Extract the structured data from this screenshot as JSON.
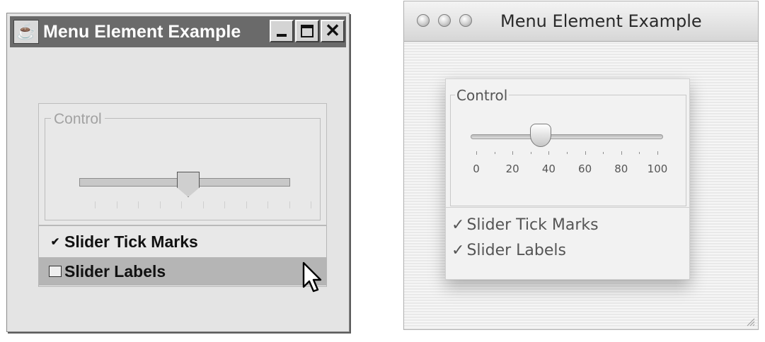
{
  "windows_example": {
    "title": "Menu Element Example",
    "app_icon": "java-cup-icon",
    "controls": {
      "minimize": "minimize-icon",
      "maximize": "maximize-icon",
      "close_label": "✕"
    },
    "group_label": "Control",
    "slider": {
      "value": 50,
      "min": 0,
      "max": 100
    },
    "menu": [
      {
        "label": "Slider Tick Marks",
        "checked": true,
        "check_glyph": "✔",
        "highlighted": false
      },
      {
        "label": "Slider Labels",
        "checked": false,
        "check_glyph": "",
        "highlighted": true
      }
    ]
  },
  "mac_example": {
    "title": "Menu Element Example",
    "group_label": "Control",
    "slider": {
      "value": 38,
      "min": 0,
      "max": 100
    },
    "tick_labels": [
      "0",
      "20",
      "40",
      "60",
      "80",
      "100"
    ],
    "menu": [
      {
        "label": "Slider Tick Marks",
        "checked": true,
        "check_glyph": "✓"
      },
      {
        "label": "Slider Labels",
        "checked": true,
        "check_glyph": "✓"
      }
    ]
  }
}
